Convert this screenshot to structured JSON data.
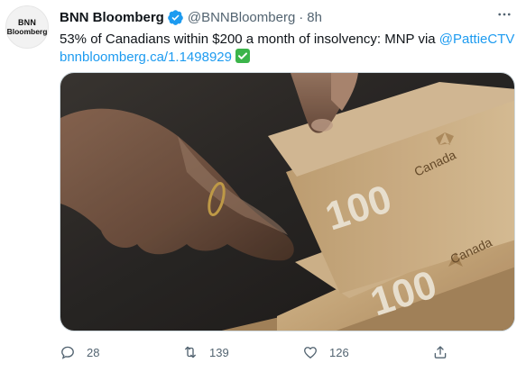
{
  "account": {
    "avatar_line1": "BNN",
    "avatar_line2": "Bloomberg",
    "name": "BNN Bloomberg",
    "handle": "@BNNBloomberg",
    "separator": "·",
    "time": "8h"
  },
  "tweet": {
    "text": "53% of Canadians within $200 a month of insolvency: MNP via ",
    "mention": "@PattieCTV",
    "link": "bnnbloomberg.ca/1.1498929"
  },
  "media": {
    "banknote_country": "Canada",
    "banknote_value": "100"
  },
  "actions": {
    "reply_count": "28",
    "retweet_count": "139",
    "like_count": "126"
  },
  "colors": {
    "link": "#1d9bf0",
    "verified": "#1d9bf0",
    "text_secondary": "#536471"
  }
}
